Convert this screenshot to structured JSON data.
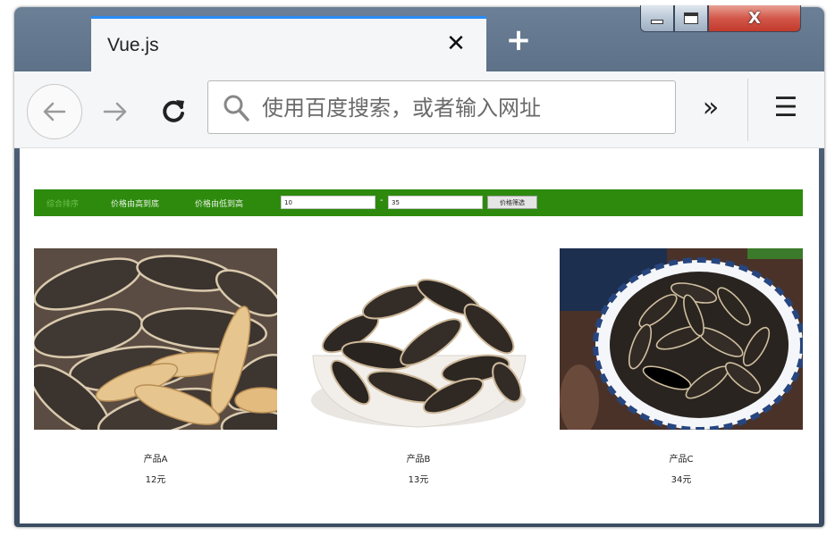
{
  "browser": {
    "tab_title": "Vue.js",
    "tab_close_glyph": "✕",
    "new_tab_glyph": "+",
    "address_placeholder": "使用百度搜索，或者输入网址",
    "overflow_glyph": "»",
    "menu_glyph": "☰",
    "window_close_glyph": "X"
  },
  "filter_bar": {
    "color": "#2d8a0d",
    "sort_options": [
      "综合排序",
      "价格由高到底",
      "价格由低到高"
    ],
    "min_price": "10",
    "range_separator": "-",
    "max_price": "35",
    "filter_button": "价格筛选"
  },
  "products": [
    {
      "name": "产品A",
      "price": "12元",
      "image": "sunflower-seeds-pile"
    },
    {
      "name": "产品B",
      "price": "13元",
      "image": "sunflower-seeds-white-bowl"
    },
    {
      "name": "产品C",
      "price": "34元",
      "image": "sunflower-seeds-blue-bowl"
    }
  ]
}
